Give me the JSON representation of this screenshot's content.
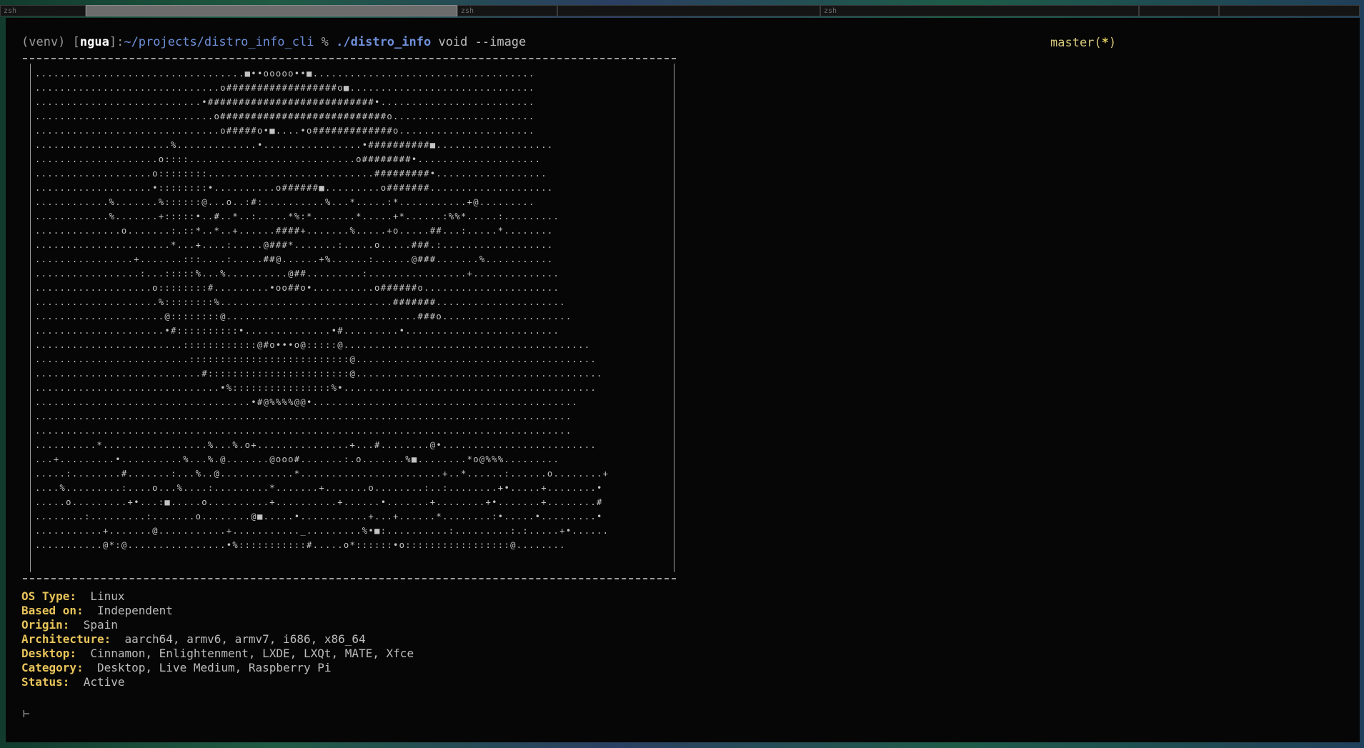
{
  "tabs": [
    {
      "label": "zsh",
      "active": false
    },
    {
      "label": "",
      "active": true
    },
    {
      "label": "zsh",
      "active": false
    },
    {
      "label": "",
      "active": false
    },
    {
      "label": "zsh",
      "active": false
    },
    {
      "label": "",
      "active": false
    },
    {
      "label": "",
      "active": false
    }
  ],
  "prompt": {
    "venv": "(venv) [",
    "user": "ngua",
    "sep": "]:",
    "path": "~/projects/distro_info_cli",
    "symbol": " % ",
    "command": "./distro_info",
    "args": " void --image"
  },
  "git": {
    "branch": "master(",
    "star": "*",
    "close": ")"
  },
  "ascii_art": [
    "..................................■••ooooo••■....................................",
    "..............................o##################o■..............................",
    "...........................•###########################•.........................",
    ".............................o###########################o.......................",
    "..............................o#####o•■....•o#############o......................",
    "......................%.............•................•##########■...................",
    "....................o::::...........................o########•....................",
    "...................o::::::::...........................#########•..................",
    "...................•::::::::•..........o######■.........o#######....................",
    "............%.......%::::::@...o..:#:..........%...*.....:*...........+@.........",
    "............%.......+:::::•..#..*..:.....*%:*.......*.....+*......:%%*.....:.........",
    "..............o.......:.::*..*..+......####+.......%.....+o.....##...:.....*........",
    "......................*...+....:.....@###*.......:.....o.....###.:..................",
    "................+.......:::....:.....##@......+%......:......@###.......%...........",
    ".................:...:::::%...%..........@##.........:................+..............",
    "...................o::::::::#.........•oo##o•..........o######o......................",
    "....................%::::::::%............................#######.....................",
    ".....................@::::::::@...............................###o.....................",
    ".....................•#::::::::::•..............•#.........•.........................",
    "........................::::::::::::@#o•••o@:::::@........................................",
    ".........................::::::::::::::::::::::::::@.......................................",
    "...........................#:::::::::::::::::::::::@........................................",
    "..............................•%::::::::::::::::%•.........................................",
    "...................................•#@%%%%@@•...........................................",
    ".......................................................................................",
    ".......................................................................................",
    "..........*.................%...%.o+...............+...#........@•.........................",
    "...+.........•..........%...%.@.......@ooo#.......:.o.......%■........*o@%%%.........",
    ".....:........#.......:...%..@............*.......................+..*......:......o........+",
    "....%.........:....o...%....:.........*.......+.......o........:..:........+•.....+........•",
    ".....o.........+•...:■.....o..........+..........+......•.......+........+•.......+........#",
    "........:.........:.......o........@■.....•...........+...+......*........:•.....•.........•",
    "...........+.......@...........+..........._.........%•■:..........:.........:.:.....+•......",
    "...........@*:@................•%:::::::::::#.....o*::::::•o:::::::::::::::::@........"
  ],
  "info": [
    {
      "key": "OS Type:",
      "value": "  Linux"
    },
    {
      "key": "Based on:",
      "value": "  Independent"
    },
    {
      "key": "Origin:",
      "value": "  Spain"
    },
    {
      "key": "Architecture:",
      "value": "  aarch64, armv6, armv7, i686, x86_64"
    },
    {
      "key": "Desktop:",
      "value": "  Cinnamon, Enlightenment, LXDE, LXQt, MATE, Xfce"
    },
    {
      "key": "Category:",
      "value": "  Desktop, Live Medium, Raspberry Pi"
    },
    {
      "key": "Status:",
      "value": "  Active"
    }
  ],
  "cursor": "⊢"
}
